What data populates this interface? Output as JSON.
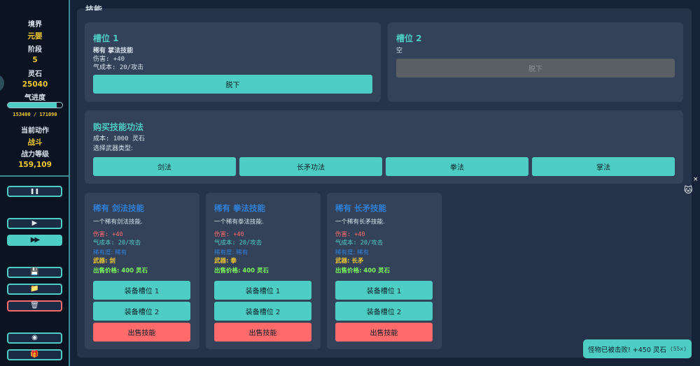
{
  "sidebar": {
    "realm_label": "境界",
    "realm_value": "元婴",
    "stage_label": "阶段",
    "stage_value": "5",
    "stones_label": "灵石",
    "stones_value": "25040",
    "qi_label": "气进度",
    "qi_progress": 0.9,
    "qi_text": "153400 / 171090",
    "action_label": "当前动作",
    "action_value": "战斗",
    "power_label": "战力等级",
    "power_value": "159,109",
    "buttons": {
      "pause": "❚❚",
      "play": "▶",
      "fast": "▶▶",
      "save": "💾",
      "load": "📁",
      "delete": "🗑",
      "discord": "◉",
      "gift": "🎁"
    }
  },
  "panel": {
    "title": "技能",
    "slot1": {
      "title": "槽位 1",
      "line1": "稀有 掌法技能",
      "line2": "伤害: +40",
      "line3": "气成本: 20/攻击",
      "button": "脱下"
    },
    "slot2": {
      "title": "槽位 2",
      "empty": "空",
      "button": "脱下"
    },
    "buy": {
      "title": "购买技能功法",
      "cost": "成本: 1000 灵石",
      "choose": "选择武器类型:",
      "types": [
        "剑法",
        "长矛功法",
        "拳法",
        "掌法"
      ]
    },
    "skills": [
      {
        "name": "稀有 剑法技能",
        "desc": "一个稀有剑法技能.",
        "damage": "伤害: +40",
        "qi": "气成本: 20/攻击",
        "rarity": "稀有度: 稀有",
        "weapon": "武器: 剑",
        "price": "出售价格: 400 灵石",
        "equip1": "装备槽位 1",
        "equip2": "装备槽位 2",
        "sell": "出售技能"
      },
      {
        "name": "稀有 拳法技能",
        "desc": "一个稀有拳法技能.",
        "damage": "伤害: +40",
        "qi": "气成本: 20/攻击",
        "rarity": "稀有度: 稀有",
        "weapon": "武器: 拳",
        "price": "出售价格: 400 灵石",
        "equip1": "装备槽位 1",
        "equip2": "装备槽位 2",
        "sell": "出售技能"
      },
      {
        "name": "稀有 长矛技能",
        "desc": "一个稀有长矛技能.",
        "damage": "伤害: +40",
        "qi": "气成本: 20/攻击",
        "rarity": "稀有度: 稀有",
        "weapon": "武器: 长矛",
        "price": "出售价格: 400 灵石",
        "equip1": "装备槽位 1",
        "equip2": "装备槽位 2",
        "sell": "出售技能"
      }
    ]
  },
  "toast": {
    "text": "怪物已被击败! +450 灵石",
    "count": "(55x)"
  },
  "overlay": {
    "close": "×",
    "cat": "🐱"
  },
  "colors": {
    "accent": "#4ecdc4",
    "danger": "#ff6b6b",
    "gold": "#f0c830",
    "rarity": "#2f7fd6",
    "price": "#7dff5a"
  }
}
